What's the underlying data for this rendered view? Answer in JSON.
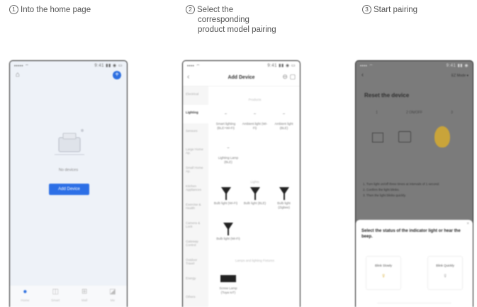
{
  "steps": [
    {
      "num": "1",
      "lines": [
        "Into the home page"
      ]
    },
    {
      "num": "2",
      "lines": [
        "Select the",
        "corresponding",
        "product model pairing"
      ]
    },
    {
      "num": "3",
      "lines": [
        "Start pairing"
      ]
    }
  ],
  "home": {
    "status_left": "••••• ⌔",
    "status_right": "9:41 ▮▮ ◉ ▭",
    "home_icon": "house-icon",
    "add_icon": "plus-icon",
    "no_devices": "No devices",
    "add_button": "Add Device",
    "tabs": [
      {
        "icon": "home-tab-icon",
        "label": "Home"
      },
      {
        "icon": "smart-tab-icon",
        "label": "Smart"
      },
      {
        "icon": "mall-tab-icon",
        "label": "Mall"
      },
      {
        "icon": "me-tab-icon",
        "label": "Me"
      }
    ]
  },
  "add_device": {
    "status_left": "•••• ⌔",
    "status_right": "9:41 ▮▮ ◉ ▭",
    "title": "Add Device",
    "categories": [
      "Electrical",
      "Lighting",
      "Sensors",
      "Large Home Ap.",
      "Small Home Ap.",
      "Kitchen Appliances",
      "Exercise & Health",
      "Camera & Lock",
      "Gateway Control",
      "Outdoor Travel",
      "Energy",
      "Others"
    ],
    "sections": [
      "Products",
      "Lights",
      "Lamps and lighting Fixtures"
    ],
    "row1": [
      "Smart lighting (BLE+Wi-Fi)",
      "Ambient light (Wi-Fi)",
      "Ambient light (BLE)"
    ],
    "row1b": [
      "Lighting Lamp (BLE)"
    ],
    "row2": [
      "Bulb light (Wi-Fi)",
      "Bulb light (BLE)",
      "Bulb light (Zigbee)"
    ],
    "row3": [
      "Bulb light (Wi-Fi)"
    ],
    "row4": [
      "Screw Lamp (Tuya IoT)"
    ]
  },
  "pairing": {
    "status_left": "•••• ⌔",
    "status_right": "9:41 ▮▮ ◉",
    "back_icon": "back-arrow-icon",
    "header_right": "EZ Mode ▾",
    "title": "Reset the device",
    "step_labels": [
      "1",
      "2 ON/OFF",
      "3"
    ],
    "instructions": [
      "1. Turn light on/off three times at intervals of 1 second.",
      "2. Confirm the light blinks.",
      "3. Then the light blinks quickly."
    ],
    "sheet_question": "Select the status of the indicator light or hear the beep.",
    "option_a": "Blink Slowly",
    "option_b": "Blink Quickly"
  }
}
